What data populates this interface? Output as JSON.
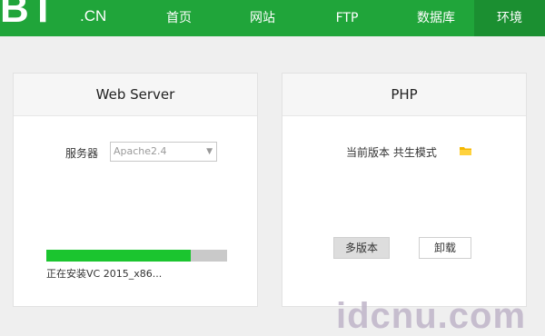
{
  "brand": {
    "logo_text": "BT",
    "suffix": ".CN",
    "color": "#20a53a"
  },
  "nav": {
    "items": [
      {
        "label": "首页"
      },
      {
        "label": "网站"
      },
      {
        "label": "FTP"
      },
      {
        "label": "数据库"
      },
      {
        "label": "环境"
      }
    ],
    "active_label": "环境"
  },
  "web_server": {
    "title": "Web Server",
    "server_label": "服务器",
    "server_value": "Apache2.4",
    "progress": 0.8,
    "progress_color": "#1bc52f",
    "status": "正在安装VC 2015_x86..."
  },
  "php": {
    "title": "PHP",
    "version_text": "当前版本 共生模式",
    "folder_icon": "folder-icon",
    "multi_version_label": "多版本",
    "uninstall_label": "卸载"
  },
  "watermark": "idcnu.com"
}
